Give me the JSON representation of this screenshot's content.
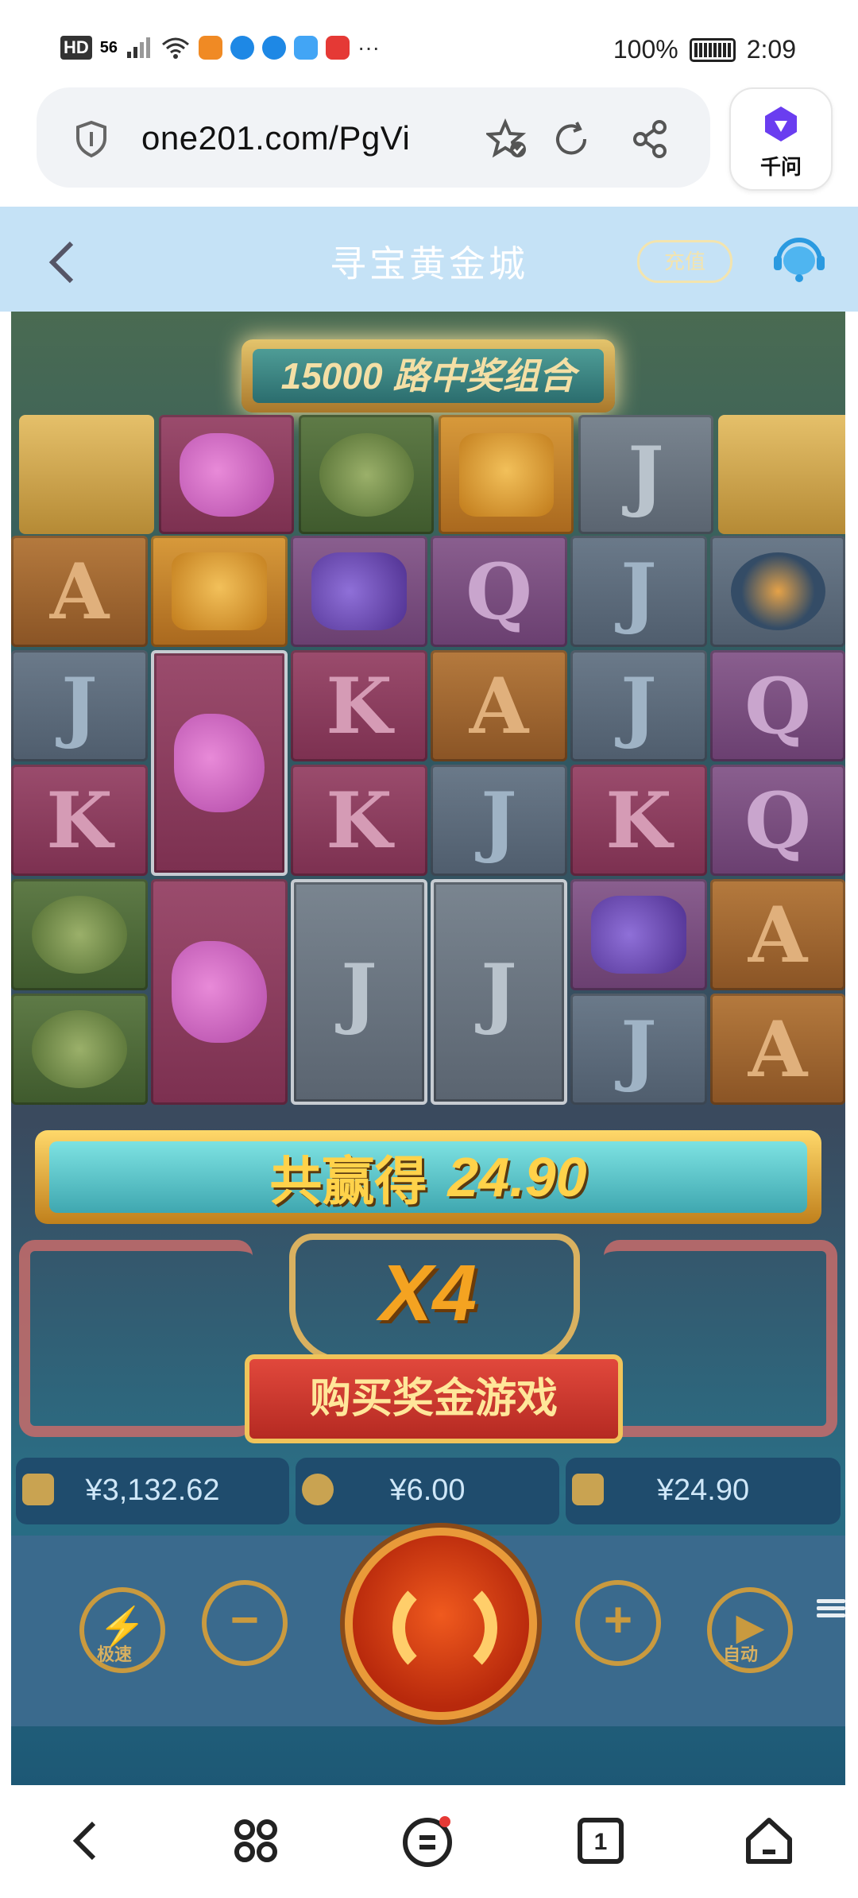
{
  "status_bar": {
    "left_badges": [
      "HD",
      "56"
    ],
    "battery_pct": "100%",
    "time": "2:09",
    "more": "···"
  },
  "browser": {
    "url": "one201.com/PgVi",
    "assistant_label": "千问"
  },
  "app_header": {
    "title": "寻宝黄金城",
    "recharge_label": "充值"
  },
  "game": {
    "ways_banner": "15000 路中奖组合",
    "grid_letters": {
      "r1": [
        "J"
      ],
      "r2": [
        "A",
        "Q",
        "J"
      ],
      "r3": [
        "J",
        "K",
        "A",
        "J",
        "Q"
      ],
      "r4": [
        "K",
        "K",
        "J",
        "K",
        "Q"
      ],
      "r5": [
        "J",
        "J",
        "A"
      ],
      "r6": [
        "J",
        "A"
      ]
    },
    "win_label": "共赢得",
    "win_amount": "24.90",
    "multiplier": "X4",
    "buy_bonus_label": "购买奖金游戏",
    "balance": "¥3,132.62",
    "bet": "¥6.00",
    "win_total": "¥24.90",
    "turbo_label": "极速",
    "auto_label": "自动",
    "minus_label": "−",
    "plus_label": "+"
  },
  "colors": {
    "header_bg": "#c5e2f6",
    "spin_red": "#e8471a",
    "gold": "#f0c45a"
  }
}
